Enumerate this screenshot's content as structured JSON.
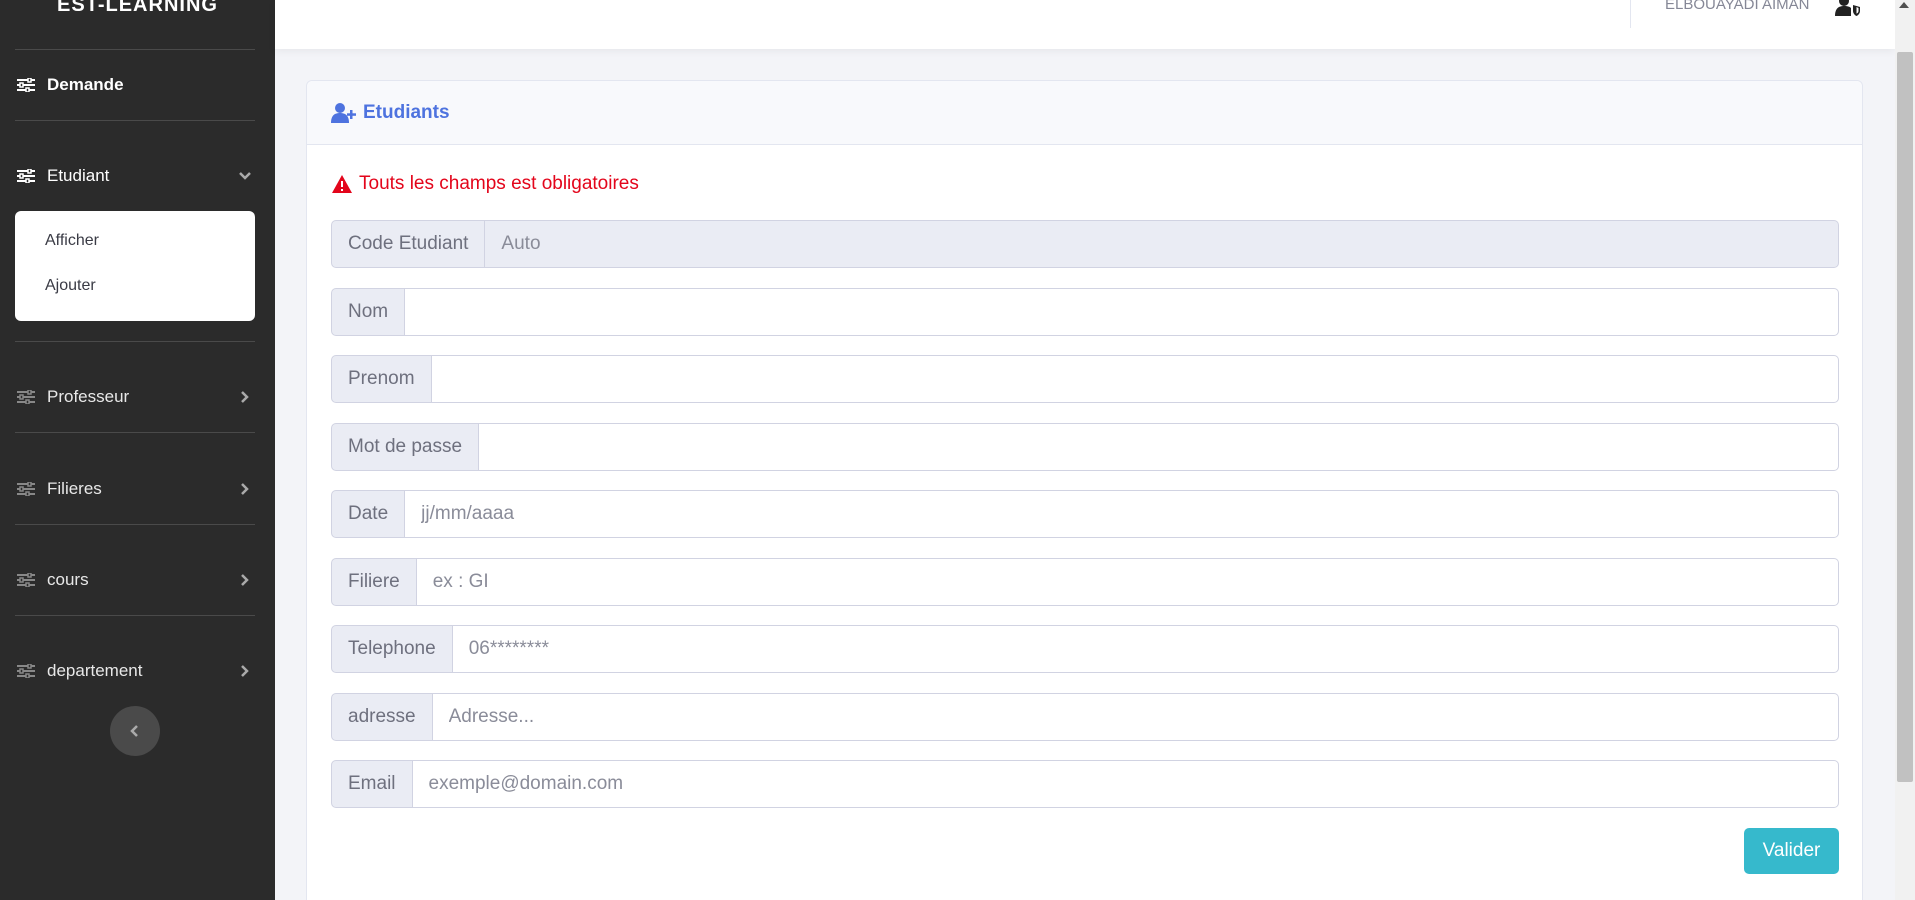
{
  "sidebar": {
    "brand": "EST-LEARNING",
    "items": [
      {
        "label": "Demande",
        "icon": "sliders-icon"
      },
      {
        "label": "Etudiant",
        "icon": "sliders-icon",
        "chevron": "chevron-down-icon"
      },
      {
        "label": "Professeur",
        "icon": "sliders-icon",
        "chevron": "chevron-right-icon"
      },
      {
        "label": "Filieres",
        "icon": "sliders-icon",
        "chevron": "chevron-right-icon"
      },
      {
        "label": "cours",
        "icon": "sliders-icon",
        "chevron": "chevron-right-icon"
      },
      {
        "label": "departement",
        "icon": "sliders-icon",
        "chevron": "chevron-right-icon"
      }
    ],
    "submenu": [
      "Afficher",
      "Ajouter"
    ]
  },
  "topbar": {
    "user_name": "ELBOUAYADI AIMAN",
    "user_icon": "user-shield-icon"
  },
  "card": {
    "title": "Etudiants",
    "title_icon": "user-plus-icon",
    "alert": "Touts les champs est obligatoires",
    "alert_icon": "warning-icon",
    "fields": [
      {
        "label": "Code Etudiant",
        "value": "",
        "placeholder": "Auto"
      },
      {
        "label": "Nom",
        "value": "",
        "placeholder": ""
      },
      {
        "label": "Prenom",
        "value": "",
        "placeholder": ""
      },
      {
        "label": "Mot de passe",
        "value": "",
        "placeholder": ""
      },
      {
        "label": "Date",
        "value": "",
        "placeholder": "jj/mm/aaaa"
      },
      {
        "label": "Filiere",
        "value": "",
        "placeholder": "ex : GI"
      },
      {
        "label": "Telephone",
        "value": "",
        "placeholder": "06********"
      },
      {
        "label": "adresse",
        "value": "",
        "placeholder": "Adresse..."
      },
      {
        "label": "Email",
        "value": "",
        "placeholder": "exemple@domain.com"
      }
    ],
    "submit_label": "Valider"
  },
  "colors": {
    "sidebar_bg": "#2b2b2b",
    "primary": "#4e73df",
    "danger": "#e3051b",
    "info": "#36b9cc"
  }
}
